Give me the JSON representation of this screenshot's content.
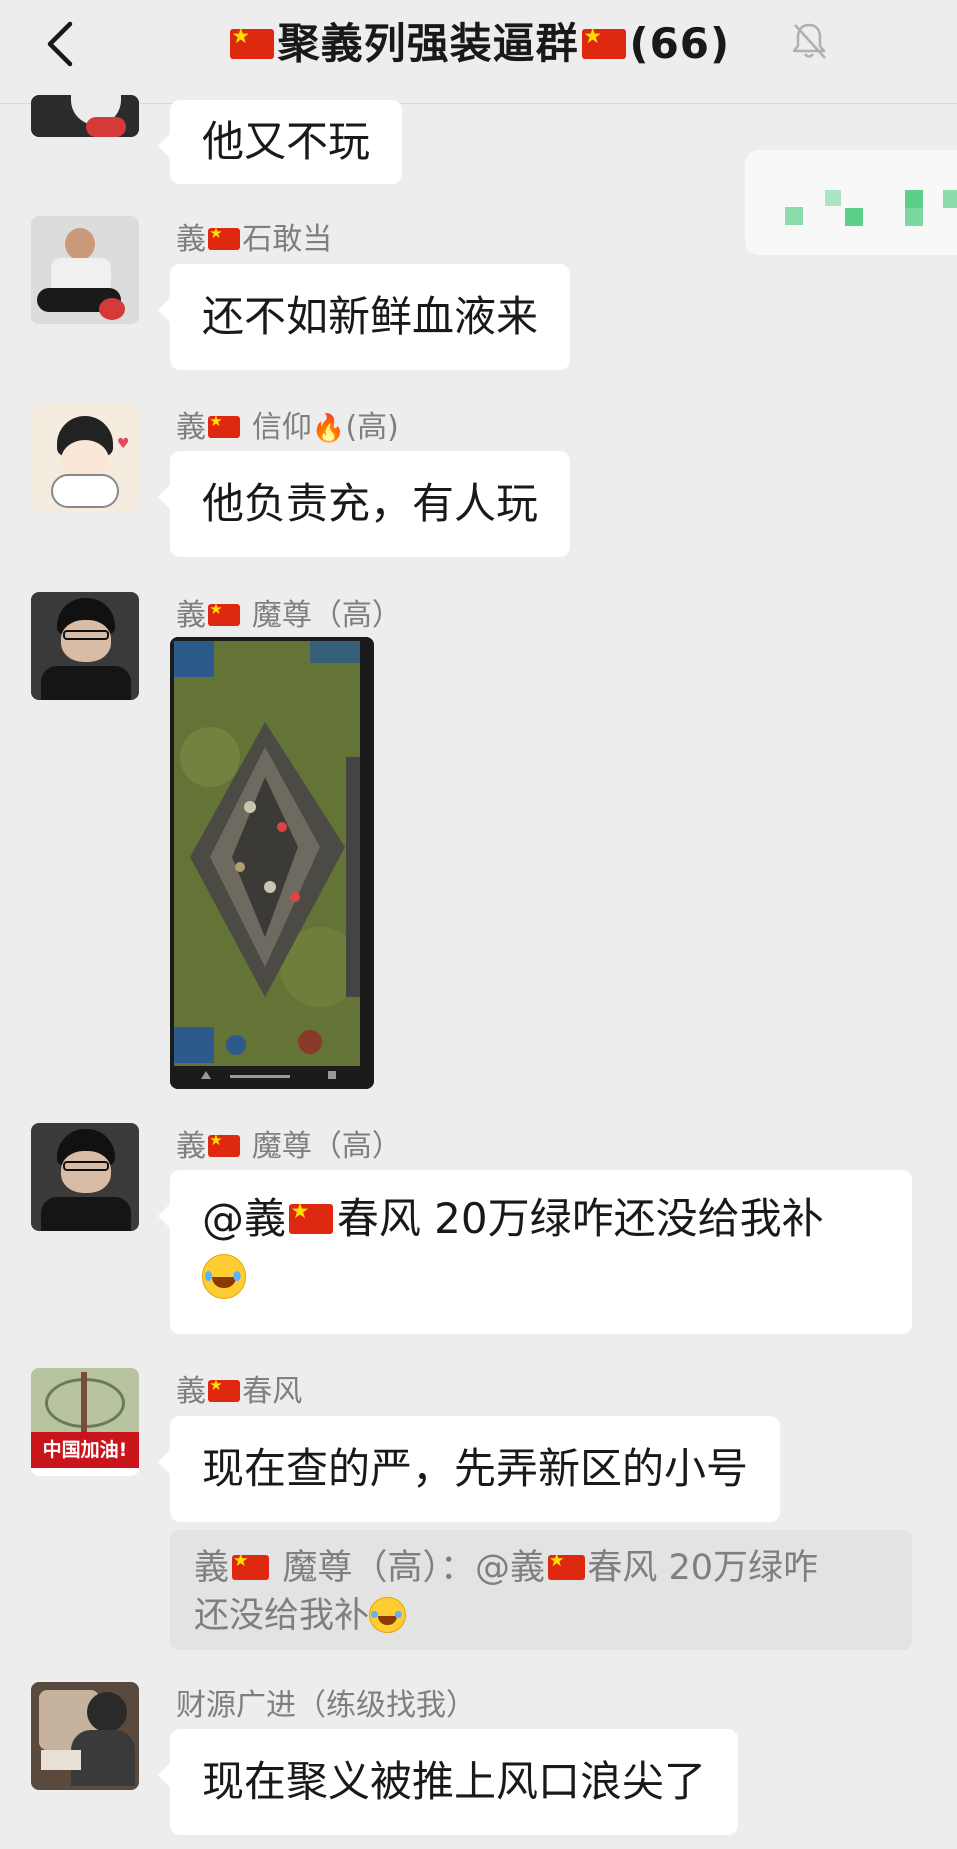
{
  "header": {
    "back_icon": "chevron-left-icon",
    "title_prefix": "聚義列强装逼群",
    "member_count": "(66)",
    "mute_icon": "bell-muted-icon"
  },
  "messages": [
    {
      "id": "m0",
      "sender": "",
      "text": "他又不玩"
    },
    {
      "id": "m1",
      "sender_a": "義",
      "sender_b": "石敢当",
      "text": "还不如新鲜血液来"
    },
    {
      "id": "m2",
      "sender_a": "義",
      "sender_b": " 信仰",
      "sender_c": "(高)",
      "text": "他负责充，有人玩"
    },
    {
      "id": "m3",
      "sender_a": "義",
      "sender_b": " 魔尊（高）",
      "image": "game-screenshot"
    },
    {
      "id": "m4",
      "sender_a": "義",
      "sender_b": " 魔尊（高）",
      "text_a": "@義",
      "text_b": "春风 20万绿咋还没给我补"
    },
    {
      "id": "m5",
      "sender_a": "義",
      "sender_b": "春风",
      "text": "现在查的严，先弄新区的小号",
      "quote_a": "義",
      "quote_b": " 魔尊（高）：@義",
      "quote_c": "春风 20万绿咋",
      "quote_d": "还没给我补"
    },
    {
      "id": "m6",
      "sender": "财源广进（练级找我）",
      "text": "现在聚义被推上风口浪尖了"
    }
  ],
  "avatar6_badge": "中国加油!",
  "colors": {
    "background": "#ededed",
    "bubble": "#ffffff",
    "name": "#7f7f7f",
    "quote_bg": "#e3e3e3"
  }
}
